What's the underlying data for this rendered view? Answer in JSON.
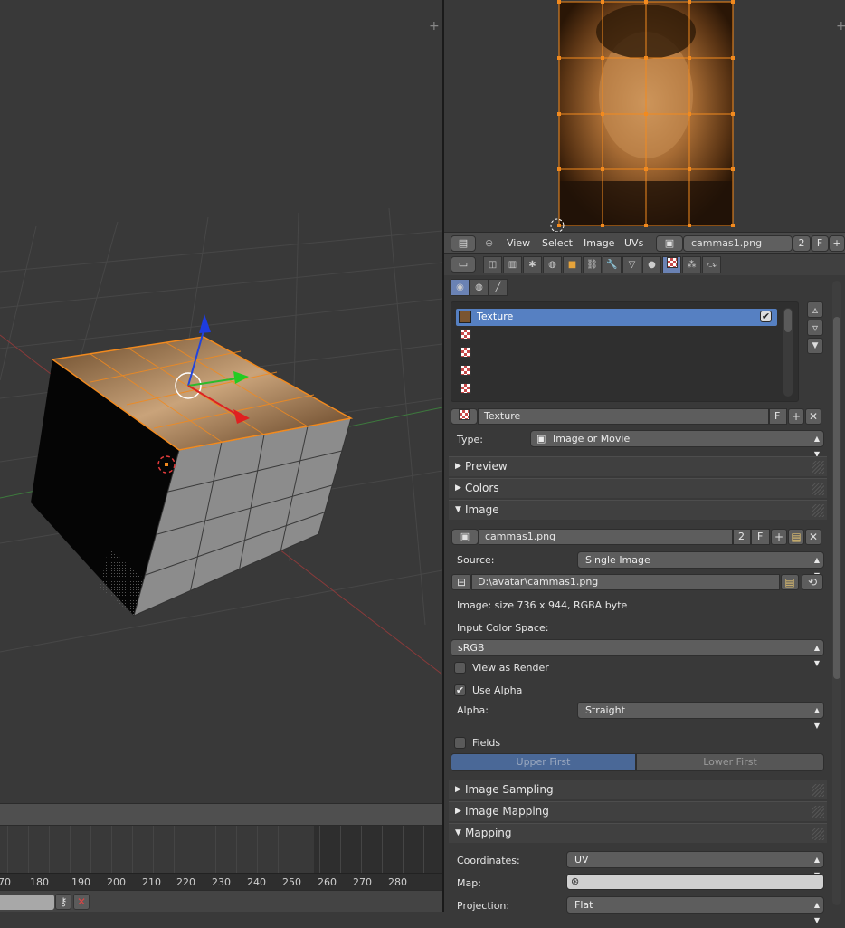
{
  "uv_header": {
    "menus": [
      "View",
      "Select",
      "Image",
      "UVs"
    ],
    "image_name": "cammas1.png",
    "users": "2",
    "fake_user": "F"
  },
  "props": {
    "texture_slots": [
      "Texture",
      "",
      "",
      "",
      ""
    ],
    "texture_name": "Texture",
    "texture_fake": "F",
    "type_label": "Type:",
    "type_value": "Image or Movie",
    "panels": {
      "preview": "Preview",
      "colors": "Colors",
      "image": "Image",
      "image_sampling": "Image Sampling",
      "image_mapping": "Image Mapping",
      "mapping": "Mapping"
    },
    "image": {
      "name": "cammas1.png",
      "users": "2",
      "fake": "F",
      "source_label": "Source:",
      "source_value": "Single Image",
      "path": "D:\\avatar\\cammas1.png",
      "info": "Image: size 736 x 944, RGBA byte",
      "color_space_label": "Input Color Space:",
      "color_space_value": "sRGB",
      "view_as_render": "View as Render",
      "use_alpha": "Use Alpha",
      "alpha_label": "Alpha:",
      "alpha_value": "Straight",
      "fields": "Fields",
      "upper_first": "Upper First",
      "lower_first": "Lower First"
    },
    "mapping": {
      "coordinates_label": "Coordinates:",
      "coordinates_value": "UV",
      "map_label": "Map:",
      "projection_label": "Projection:",
      "projection_value": "Flat"
    }
  },
  "timeline": {
    "frames": [
      "70",
      "180",
      "190",
      "200",
      "210",
      "220",
      "230",
      "240",
      "250",
      "260",
      "270",
      "280"
    ]
  },
  "colors": {
    "selection_orange": "#f28a1e",
    "active_blue": "#5680c2",
    "background": "#393939"
  }
}
